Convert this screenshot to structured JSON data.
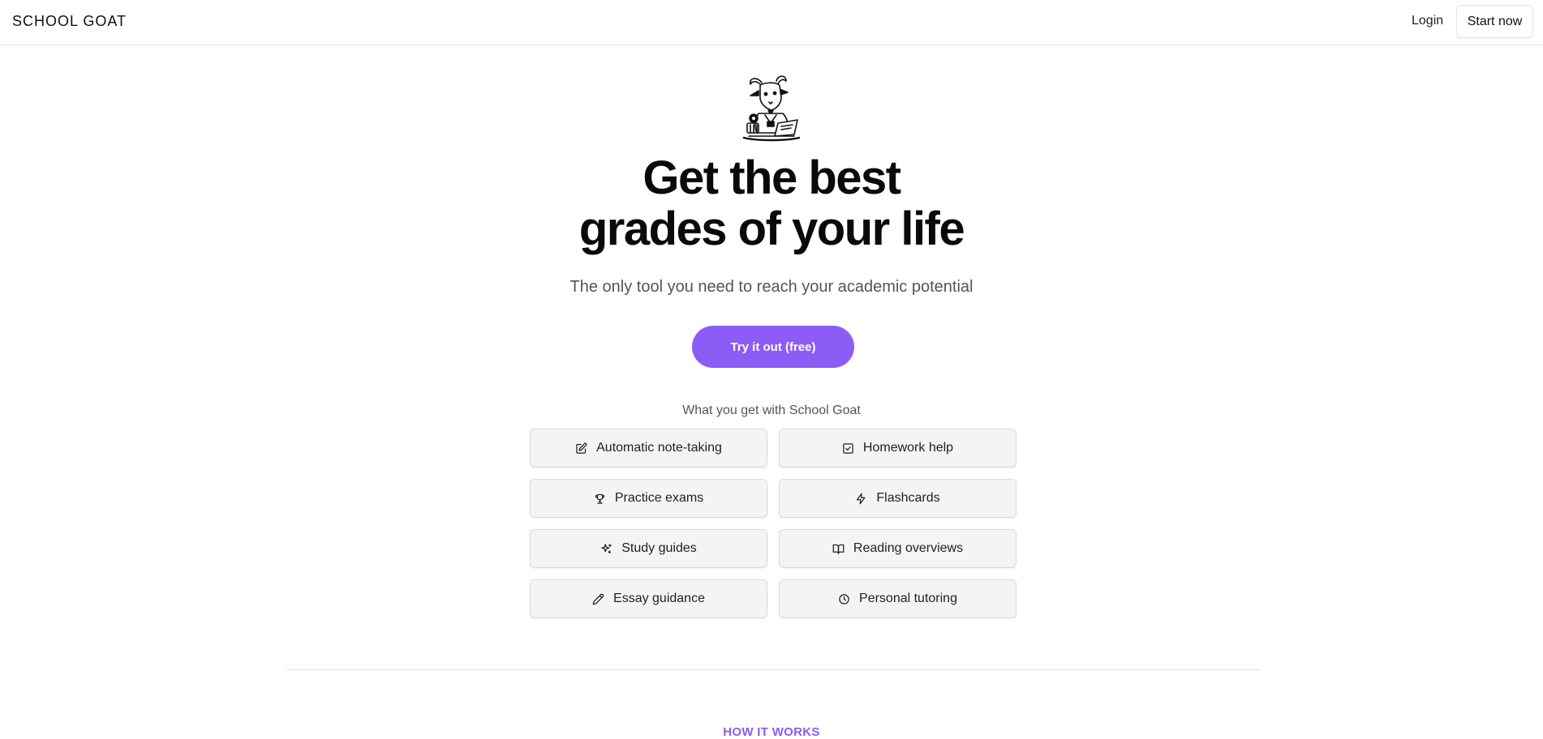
{
  "header": {
    "brand": "SCHOOL GOAT",
    "login_label": "Login",
    "start_label": "Start now"
  },
  "hero": {
    "headline_line1": "Get the best",
    "headline_line2": "grades of your life",
    "subheadline": "The only tool you need to reach your academic potential",
    "cta_label": "Try it out (free)"
  },
  "features": {
    "title": "What you get with School Goat",
    "items": [
      {
        "label": "Automatic note-taking",
        "icon": "edit-note-icon"
      },
      {
        "label": "Homework help",
        "icon": "check-square-icon"
      },
      {
        "label": "Practice exams",
        "icon": "trophy-icon"
      },
      {
        "label": "Flashcards",
        "icon": "lightning-icon"
      },
      {
        "label": "Study guides",
        "icon": "sparkles-icon"
      },
      {
        "label": "Reading overviews",
        "icon": "book-open-icon"
      },
      {
        "label": "Essay guidance",
        "icon": "pencil-icon"
      },
      {
        "label": "Personal tutoring",
        "icon": "clock-icon"
      }
    ]
  },
  "how_it_works": {
    "label": "HOW IT WORKS"
  },
  "colors": {
    "accent": "#8b5cf6",
    "feature_bg": "#f3f4f6",
    "border": "#e4e4e7"
  }
}
